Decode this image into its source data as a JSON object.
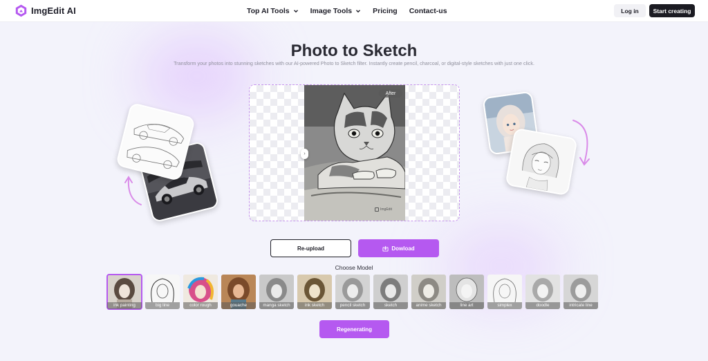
{
  "nav": {
    "logo_text": "ImgEdit AI",
    "menu": [
      {
        "label": "Top AI Tools",
        "has_dropdown": true
      },
      {
        "label": "Image Tools",
        "has_dropdown": true
      },
      {
        "label": "Pricing",
        "has_dropdown": false
      },
      {
        "label": "Contact-us",
        "has_dropdown": false
      }
    ],
    "login_label": "Log in",
    "start_label": "Start creating"
  },
  "hero": {
    "title": "Photo to Sketch",
    "subtitle": "Transform your photos into stunning sketches with our AI-powered Photo to Sketch filter. Instantly create pencil, charcoal, or digital-style sketches with just one click."
  },
  "preview": {
    "after_badge": "After",
    "watermark": "ImgEdit"
  },
  "actions": {
    "reupload_label": "Re-upload",
    "download_label": "Dowload",
    "choose_model_label": "Choose Model",
    "regenerate_label": "Regenerating"
  },
  "models": [
    {
      "label": "ink painting",
      "selected": true
    },
    {
      "label": "big line",
      "selected": false
    },
    {
      "label": "color rough",
      "selected": false
    },
    {
      "label": "gouache",
      "selected": false
    },
    {
      "label": "manga sketch",
      "selected": false
    },
    {
      "label": "ink sketch",
      "selected": false
    },
    {
      "label": "pencil sketch",
      "selected": false
    },
    {
      "label": "sketch",
      "selected": false
    },
    {
      "label": "anime sketch",
      "selected": false
    },
    {
      "label": "line art",
      "selected": false
    },
    {
      "label": "simplex",
      "selected": false
    },
    {
      "label": "doodle",
      "selected": false
    },
    {
      "label": "intricate line",
      "selected": false
    }
  ],
  "colors": {
    "accent": "#b559f0",
    "dark": "#1b1b22",
    "background": "#f3f3fb"
  }
}
